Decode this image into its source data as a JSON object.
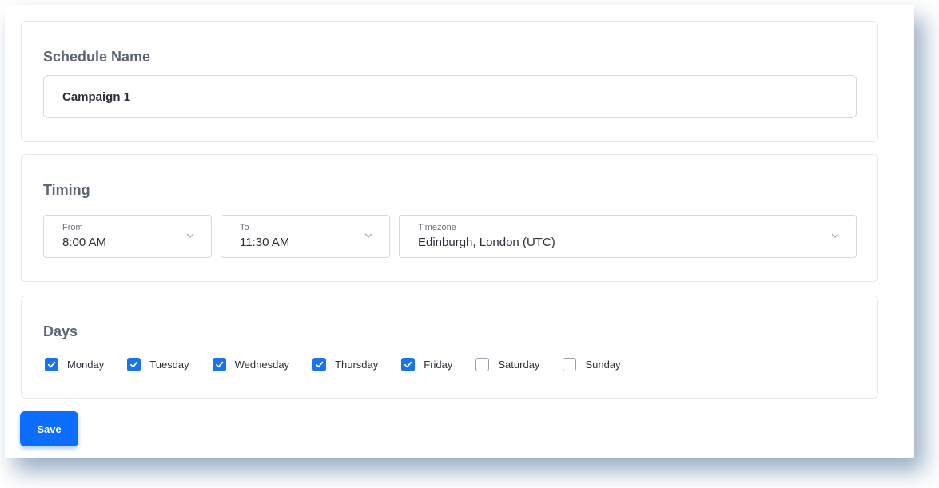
{
  "schedule": {
    "title": "Schedule Name",
    "name_value": "Campaign 1"
  },
  "timing": {
    "title": "Timing",
    "from": {
      "label": "From",
      "value": "8:00 AM"
    },
    "to": {
      "label": "To",
      "value": "11:30 AM"
    },
    "timezone": {
      "label": "Timezone",
      "value": "Edinburgh, London (UTC)"
    }
  },
  "days": {
    "title": "Days",
    "items": [
      {
        "label": "Monday",
        "checked": true
      },
      {
        "label": "Tuesday",
        "checked": true
      },
      {
        "label": "Wednesday",
        "checked": true
      },
      {
        "label": "Thursday",
        "checked": true
      },
      {
        "label": "Friday",
        "checked": true
      },
      {
        "label": "Saturday",
        "checked": false
      },
      {
        "label": "Sunday",
        "checked": false
      }
    ]
  },
  "actions": {
    "save_label": "Save"
  },
  "colors": {
    "accent": "#0d6efd",
    "checkbox": "#1a73e8",
    "heading": "#5d6575",
    "border": "#d5d9e0"
  },
  "icons": {
    "dropdown": "chevron-down-icon",
    "check": "checkmark-icon"
  }
}
